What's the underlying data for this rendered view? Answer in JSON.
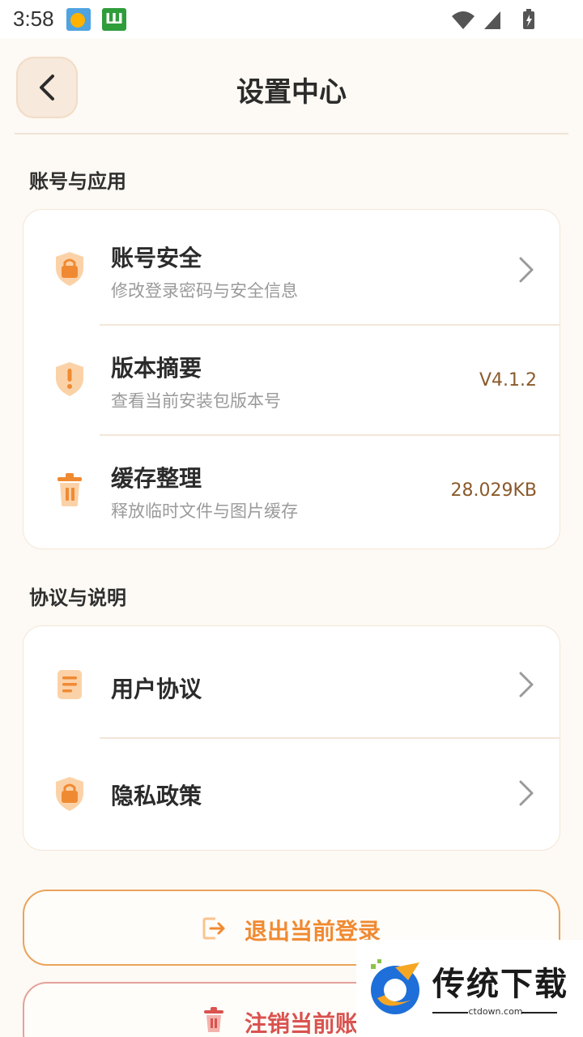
{
  "status_bar": {
    "time": "3:58",
    "app2_label": "Ш"
  },
  "header": {
    "title": "设置中心"
  },
  "sections": {
    "account_title": "账号与应用",
    "agreement_title": "协议与说明"
  },
  "account_rows": [
    {
      "title": "账号安全",
      "subtitle": "修改登录密码与安全信息",
      "icon": "shield-lock-icon"
    },
    {
      "title": "版本摘要",
      "subtitle": "查看当前安装包版本号",
      "value": "V4.1.2",
      "icon": "shield-exclamation-icon"
    },
    {
      "title": "缓存整理",
      "subtitle": "释放临时文件与图片缓存",
      "value": "28.029KB",
      "icon": "trash-icon"
    }
  ],
  "agreement_rows": [
    {
      "title": "用户协议",
      "icon": "document-icon"
    },
    {
      "title": "隐私政策",
      "icon": "shield-lock-icon"
    }
  ],
  "buttons": {
    "logout": "退出当前登录",
    "delete_account": "注销当前账"
  },
  "watermark": {
    "brand": "传统下载",
    "domain": "ctdown.com"
  },
  "colors": {
    "accent": "#f08a32",
    "accent_light": "#fbd2a8",
    "danger": "#d9534f",
    "value": "#8a5a2b",
    "background": "#fdf9f4"
  }
}
